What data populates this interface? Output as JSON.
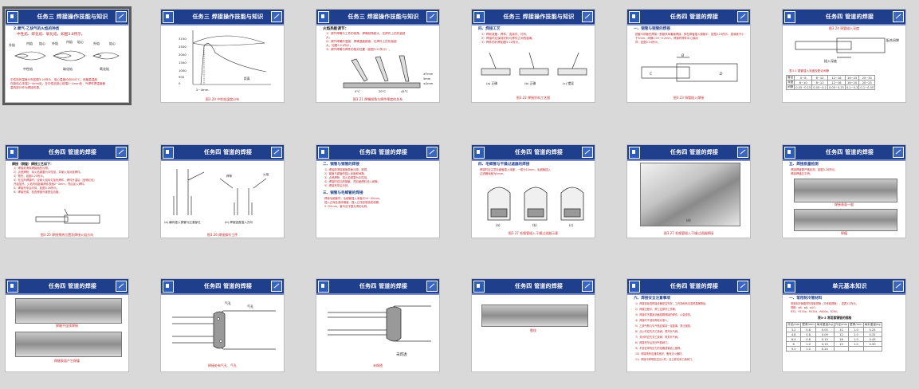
{
  "colors": {
    "header_bg": "#1f3e8c",
    "accent_red": "#c0272d",
    "canvas_bg": "#d9d9d9"
  },
  "slides": [
    {
      "title": "任务三 焊接操作技能与知识",
      "heading": "2.氧气-乙炔气的火焰的种类",
      "sub": "中性焰、碳化焰、氧化焰，如图3.8所示。",
      "labels": [
        "外焰",
        "内焰",
        "焰心",
        "外焰",
        "内焰",
        "焰心",
        "外焰",
        "焰心",
        "中性焰",
        "碳化焰",
        "氧化焰"
      ],
      "body": [
        "中性焰的温度分布如图3.20所示，焰心温度约在800°C，而最高温度",
        "在距焰心末端2~4mm处，在中性焰焰心前端2~4mm处，气焊时把温度最",
        "高的部分作为焊接热源。"
      ]
    },
    {
      "title": "任务三 焊接操作技能与知识",
      "caption": "图3.20 中性焰温度分布",
      "axis": [
        "3150",
        "2500",
        "2000",
        "1500",
        "1000",
        "500",
        "0"
      ],
      "xlab": "2~4mm",
      "curve": "距离"
    },
    {
      "title": "任务三 焊接操作技能与知识",
      "heading": "火焰热能调节：",
      "items": [
        "1）调节焊嘴与工件的倾角，焊嘴倾角越大，在焊件上的热量越",
        "大；",
        "2）调节焊嘴的温度，焊嘴温度越高，在焊件上的热量越",
        "大，如图3.21所示；",
        "3）调节焊嘴与焊件的相对位置（如图3.21所示）。"
      ],
      "caption": "图3.21 焊嘴倾角与焊件厚度的关系",
      "labels": [
        "≥7mm",
        "5mm",
        "≤1mm",
        "0°C",
        "20°C",
        "45°C"
      ]
    },
    {
      "title": "任务三 焊接操作技能与知识",
      "heading": "四、焊接工艺",
      "items": [
        "1）焊前准备：焊件、连接件、钎料、",
        "2）焊接时应保持钎料与焊件之间的距离。",
        "3）焊件的钎焊如图3.22所示。"
      ],
      "labels": [
        "(a) 正确",
        "(b) 正确",
        "(c) 错误"
      ],
      "caption": "图3.22 焊接钎料工艺图"
    },
    {
      "title": "任务四 管道的焊接",
      "heading": "一、铜管与铜管的焊接",
      "body": [
        "铜管与铜管的焊接一般都采用套管焊接，即在铜管插入铜管中，如图3.23所示，插深度不小",
        "于5mm，间隙0.05~0.2mm，焊接时焊件中心保持",
        "同，如图3.24所示。"
      ],
      "labels": [
        "B",
        "C",
        "D"
      ],
      "caption": "图3.23 铜管插入焊接"
    },
    {
      "title": "任务四 管道的焊接",
      "caption_top": "图3.24 铜管插入深度",
      "labels": [
        "插入深度",
        "配合间隙"
      ],
      "note": "表3-1 铜管插入深度及配合间隙",
      "rows": [
        [
          "管径",
          "5~8",
          "8~12",
          "12~16",
          "16~25",
          "25~35"
        ],
        [
          "深度",
          "6~10",
          "8~12",
          "12~16",
          "16~20",
          "20~25"
        ],
        [
          "间隙",
          "0.05~0.15",
          "0.05~0.2",
          "0.05~0.25",
          "0.1~0.3",
          "0.1~0.35"
        ]
      ]
    },
    {
      "title": "任务四 管道的焊接",
      "heading": "焊接（铜管）焊接工艺如下：",
      "items": [
        "1）焊接前清除焊接面的污物。",
        "2）点燃焊枪，将火焰调整为中性焰，并使火焰对准焊件。",
        "3）预热，如图3.25所示。",
        "4）在加热焊接时，应使火焰均匀加热焊件，焊件升温后（呈暗红色）",
        "   开始加热，火焰内焰距离焊件表面2~4mm，然后加入焊料。",
        "5）焊接完毕后冷却，如图3.26所示。",
        "6）焊接完成，检查焊缝外观是否合格。"
      ],
      "caption": "图3.25 焊接预热位置及焊接火焰方向"
    },
    {
      "title": "任务四 管道的焊接",
      "labels": [
        "焊条",
        "火焰"
      ],
      "sub": [
        "(a) 横向插入铜管与过渡部位",
        "(b) 焊接竖直插入方向"
      ],
      "caption": "图3.26 焊接操作工序"
    },
    {
      "title": "任务四 管道的焊接",
      "heading": "二、铜管与钢管的焊接",
      "items": [
        "1）焊接前清除钢管表面污物、铁锈。",
        "2）钢管与铜管的插入深度和间隙。",
        "3）点燃焊枪，将火焰调整为中性焰。",
        "4）焊接时应加热钢管，然后使焊料流入间隙。",
        "5）焊接完毕后冷却。"
      ],
      "heading2": "三、铜管与毛细管的焊接",
      "items2": [
        "焊接毛细管时，毛细管插入深度约10~20mm，",
        "插入过深会造成堵塞，插入过浅容易造成泄漏。",
        "5~20mm，管口应平整光滑无毛刺。"
      ]
    },
    {
      "title": "任务四 管道的焊接",
      "heading": "四、毛细管与干燥过滤器的焊接",
      "body": [
        "焊接时应注意毛细管插入深度，一般为15mm，毛细管插入",
        "过滤器深度为5mm。"
      ],
      "labels": [
        "(a)",
        "(b)",
        "(c)"
      ],
      "caption": "图3.27 毛细管插入干燥过滤器示意"
    },
    {
      "title": "任务四 管道的焊接",
      "label": "(d)",
      "caption": "图3.27 毛细管插入干燥过滤器焊接"
    },
    {
      "title": "任务四 管道的焊接",
      "heading": "五、焊接质量检测",
      "body": [
        "焊接焊缝需严格检测，如图3.28所示。",
        "焊接焊缝应平滑。"
      ],
      "cap1": "焊接表面一般",
      "cap2": "焊瘤"
    },
    {
      "title": "任务四 管道的焊接",
      "cap1": "焊缝不连续焊接",
      "cap2": "焊缝表面产生焊瘤"
    },
    {
      "title": "任务四 管道的焊接",
      "labels": [
        "气孔",
        "气孔"
      ],
      "caption": "焊接处有气孔、气孔"
    },
    {
      "title": "任务四 管道的焊接",
      "labels": [
        "未焊透"
      ],
      "caption": "未焊透"
    },
    {
      "title": "任务四 管道的焊接",
      "caption": "裂纹"
    },
    {
      "title": "任务四 管道的焊接",
      "heading": "六、焊接安全注意事项",
      "items": [
        "1）焊接前检查焊接设备是否完好，工作场地有无易燃易爆物品。",
        "2）焊接过程中，焊工应穿好工作服。",
        "3）焊接时不要用手触碰刚焊接的焊件，以免烫伤。",
        "4）焊接时不准将焊炬对准人。",
        "5）乙炔气瓶与氧气瓶应保持一定距离，禁止倒放。",
        "6）点火时应先开乙炔阀，再开氧气阀。",
        "7）关闭时应先关乙炔阀，再关氧气阀。",
        "8）焊接完毕后关闭气瓶阀门。",
        "9）不准在带有压力的容器或管道上施焊。",
        "10）焊接场所应通风良好，备有灭火器材。",
        "11）焊接中焊嘴发生回火时，应立即关闭乙炔阀门。"
      ]
    },
    {
      "title": "单元基本知识",
      "heading": "一、常用制冷管材料",
      "body": [
        "常用制冷管路材料是紫铜管（又称纯铜管），如表3-2所示。",
        "规格：φ6、φ8、φ10；",
        "R22、R134a、R410a、R600a、R290。"
      ],
      "note": "表3-2 常用紫铜管的规格",
      "rows": [
        [
          "外径/mm",
          "壁厚/mm",
          "每米重量/kg",
          "外径/mm",
          "壁厚/mm",
          "每米重量/kg"
        ],
        [
          "3.2",
          "0.8",
          "0.05",
          "10",
          "1.0",
          "0.25"
        ],
        [
          "4.8",
          "0.8",
          "0.09",
          "12",
          "1.0",
          "0.31"
        ],
        [
          "6.4",
          "0.8",
          "0.13",
          "16",
          "1.0",
          "0.43"
        ],
        [
          "8",
          "1.0",
          "0.19",
          "19",
          "1.0",
          "0.50"
        ],
        [
          "9.5",
          "1.0",
          "0.24",
          "",
          "",
          ""
        ]
      ]
    }
  ]
}
